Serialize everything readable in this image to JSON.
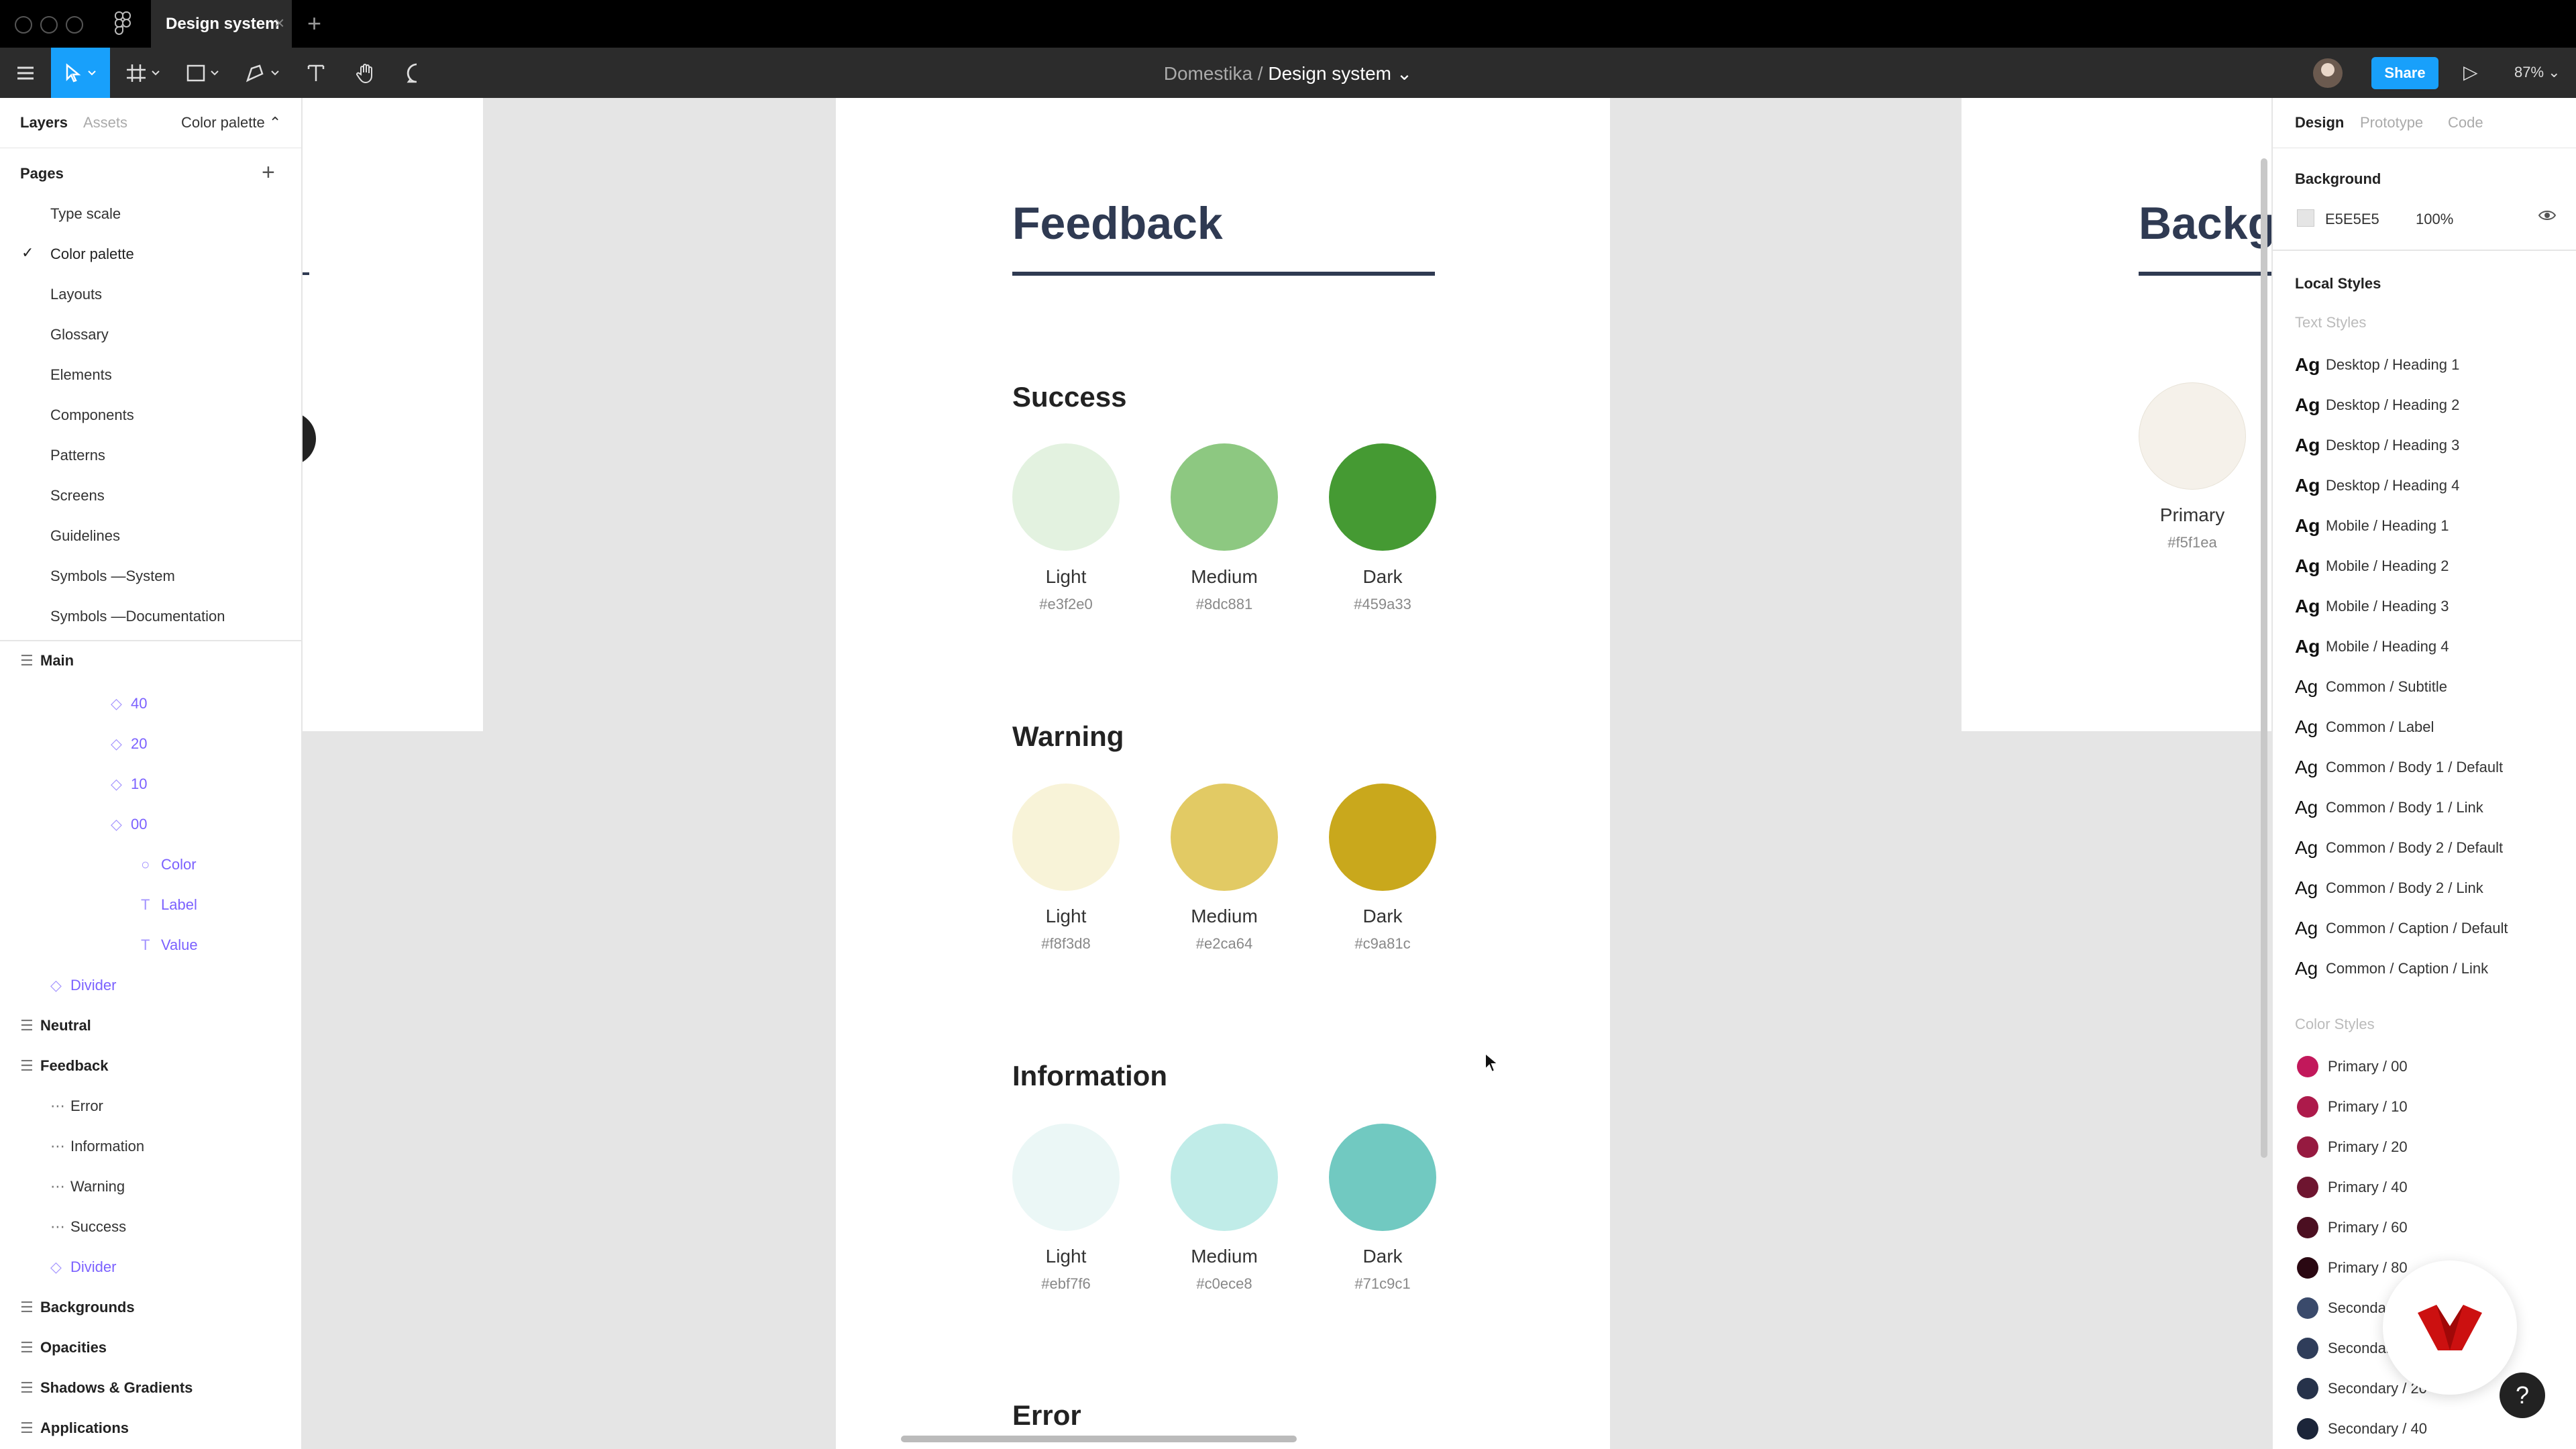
{
  "tabbar": {
    "tab_label": "Design system",
    "close": "×",
    "add": "+"
  },
  "toolbar": {
    "breadcrumb_team": "Domestika",
    "breadcrumb_sep": "/",
    "breadcrumb_file": "Design system",
    "share_label": "Share",
    "zoom": "87%"
  },
  "left_panel": {
    "tabs": [
      "Layers",
      "Assets"
    ],
    "current_page": "Color palette",
    "pages_heading": "Pages",
    "pages": [
      "Type scale",
      "Color palette",
      "Layouts",
      "Glossary",
      "Elements",
      "Components",
      "Patterns",
      "Screens",
      "Guidelines",
      "Symbols —System",
      "Symbols —Documentation"
    ],
    "layers": [
      {
        "label": "Main",
        "kind": "frame"
      },
      {
        "label": "40",
        "kind": "instance"
      },
      {
        "label": "20",
        "kind": "instance"
      },
      {
        "label": "10",
        "kind": "instance"
      },
      {
        "label": "00",
        "kind": "instance"
      },
      {
        "label": "Color",
        "kind": "ellipse"
      },
      {
        "label": "Label",
        "kind": "text"
      },
      {
        "label": "Value",
        "kind": "text"
      },
      {
        "label": "Divider",
        "kind": "instance"
      },
      {
        "label": "Neutral",
        "kind": "frame"
      },
      {
        "label": "Feedback",
        "kind": "frame"
      },
      {
        "label": "Error",
        "kind": "group"
      },
      {
        "label": "Information",
        "kind": "group"
      },
      {
        "label": "Warning",
        "kind": "group"
      },
      {
        "label": "Success",
        "kind": "group"
      },
      {
        "label": "Divider",
        "kind": "instance"
      },
      {
        "label": "Backgrounds",
        "kind": "frame"
      },
      {
        "label": "Opacities",
        "kind": "frame"
      },
      {
        "label": "Shadows & Gradients",
        "kind": "frame"
      },
      {
        "label": "Applications",
        "kind": "frame"
      }
    ]
  },
  "canvas": {
    "title": "Feedback",
    "sections": [
      {
        "name": "Success",
        "swatches": [
          {
            "label": "Light",
            "hex": "#e3f2e0"
          },
          {
            "label": "Medium",
            "hex": "#8dc881"
          },
          {
            "label": "Dark",
            "hex": "#459a33"
          }
        ]
      },
      {
        "name": "Warning",
        "swatches": [
          {
            "label": "Light",
            "hex": "#f8f3d8"
          },
          {
            "label": "Medium",
            "hex": "#e2ca64"
          },
          {
            "label": "Dark",
            "hex": "#c9a81c"
          }
        ]
      },
      {
        "name": "Information",
        "swatches": [
          {
            "label": "Light",
            "hex": "#ebf7f6"
          },
          {
            "label": "Medium",
            "hex": "#c0ece8"
          },
          {
            "label": "Dark",
            "hex": "#71c9c1"
          }
        ]
      },
      {
        "name": "Error",
        "swatches": []
      }
    ],
    "right_frame": {
      "title": "Backg",
      "swatch_label": "Primary",
      "swatch_hex": "#f5f1ea"
    }
  },
  "right_panel": {
    "tabs": [
      "Design",
      "Prototype",
      "Code"
    ],
    "background_heading": "Background",
    "background_hex": "E5E5E5",
    "background_opacity": "100%",
    "local_styles_heading": "Local Styles",
    "text_styles_heading": "Text Styles",
    "text_styles": [
      "Desktop / Heading 1",
      "Desktop / Heading 2",
      "Desktop / Heading 3",
      "Desktop / Heading 4",
      "Mobile / Heading 1",
      "Mobile / Heading 2",
      "Mobile / Heading 3",
      "Mobile / Heading 4",
      "Common / Subtitle",
      "Common / Label",
      "Common / Body 1 / Default",
      "Common / Body 1 / Link",
      "Common / Body 2 / Default",
      "Common / Body 2 / Link",
      "Common / Caption / Default",
      "Common / Caption / Link"
    ],
    "ag": "Ag",
    "color_styles_heading": "Color Styles",
    "color_styles": [
      {
        "name": "Primary / 00",
        "color": "#c2185b"
      },
      {
        "name": "Primary / 10",
        "color": "#ad1a4b"
      },
      {
        "name": "Primary / 20",
        "color": "#961a40"
      },
      {
        "name": "Primary / 40",
        "color": "#6e1530"
      },
      {
        "name": "Primary / 60",
        "color": "#4b0f21"
      },
      {
        "name": "Primary / 80",
        "color": "#2a0812"
      },
      {
        "name": "Seconda",
        "color": "#3a4a6b"
      },
      {
        "name": "Secondar",
        "color": "#2f3d5a"
      },
      {
        "name": "Secondary / 20",
        "color": "#26324a"
      },
      {
        "name": "Secondary / 40",
        "color": "#1c2539"
      }
    ]
  },
  "help_label": "?"
}
